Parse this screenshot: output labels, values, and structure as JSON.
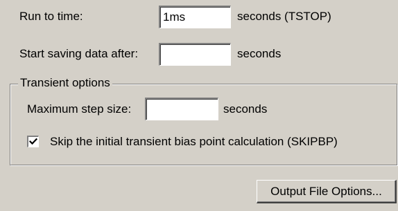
{
  "run_to_time": {
    "label": "Run to time:",
    "value": "1ms",
    "unit": "seconds  (TSTOP)"
  },
  "start_saving": {
    "label": "Start saving data after:",
    "value": "",
    "unit": "seconds"
  },
  "transient_options": {
    "title": "Transient options",
    "max_step": {
      "label": "Maximum step size:",
      "value": "",
      "unit": "seconds"
    },
    "skip_bias": {
      "label": "Skip the initial transient bias point calculation  (SKIPBP)",
      "checked": true
    }
  },
  "output_file_button": {
    "label": "Output File Options..."
  },
  "icons": {
    "checkmark": "checkmark-icon"
  }
}
